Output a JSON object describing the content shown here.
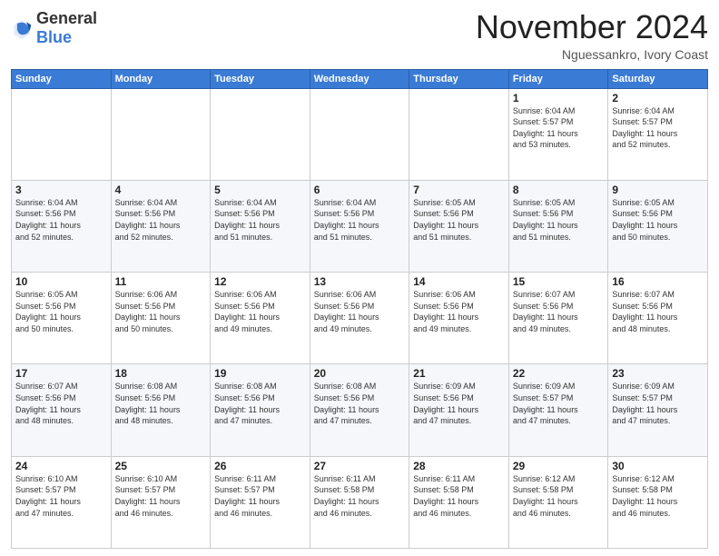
{
  "logo": {
    "general": "General",
    "blue": "Blue"
  },
  "header": {
    "month": "November 2024",
    "location": "Nguessankro, Ivory Coast"
  },
  "weekdays": [
    "Sunday",
    "Monday",
    "Tuesday",
    "Wednesday",
    "Thursday",
    "Friday",
    "Saturday"
  ],
  "weeks": [
    [
      {
        "day": "",
        "info": ""
      },
      {
        "day": "",
        "info": ""
      },
      {
        "day": "",
        "info": ""
      },
      {
        "day": "",
        "info": ""
      },
      {
        "day": "",
        "info": ""
      },
      {
        "day": "1",
        "info": "Sunrise: 6:04 AM\nSunset: 5:57 PM\nDaylight: 11 hours\nand 53 minutes."
      },
      {
        "day": "2",
        "info": "Sunrise: 6:04 AM\nSunset: 5:57 PM\nDaylight: 11 hours\nand 52 minutes."
      }
    ],
    [
      {
        "day": "3",
        "info": "Sunrise: 6:04 AM\nSunset: 5:56 PM\nDaylight: 11 hours\nand 52 minutes."
      },
      {
        "day": "4",
        "info": "Sunrise: 6:04 AM\nSunset: 5:56 PM\nDaylight: 11 hours\nand 52 minutes."
      },
      {
        "day": "5",
        "info": "Sunrise: 6:04 AM\nSunset: 5:56 PM\nDaylight: 11 hours\nand 51 minutes."
      },
      {
        "day": "6",
        "info": "Sunrise: 6:04 AM\nSunset: 5:56 PM\nDaylight: 11 hours\nand 51 minutes."
      },
      {
        "day": "7",
        "info": "Sunrise: 6:05 AM\nSunset: 5:56 PM\nDaylight: 11 hours\nand 51 minutes."
      },
      {
        "day": "8",
        "info": "Sunrise: 6:05 AM\nSunset: 5:56 PM\nDaylight: 11 hours\nand 51 minutes."
      },
      {
        "day": "9",
        "info": "Sunrise: 6:05 AM\nSunset: 5:56 PM\nDaylight: 11 hours\nand 50 minutes."
      }
    ],
    [
      {
        "day": "10",
        "info": "Sunrise: 6:05 AM\nSunset: 5:56 PM\nDaylight: 11 hours\nand 50 minutes."
      },
      {
        "day": "11",
        "info": "Sunrise: 6:06 AM\nSunset: 5:56 PM\nDaylight: 11 hours\nand 50 minutes."
      },
      {
        "day": "12",
        "info": "Sunrise: 6:06 AM\nSunset: 5:56 PM\nDaylight: 11 hours\nand 49 minutes."
      },
      {
        "day": "13",
        "info": "Sunrise: 6:06 AM\nSunset: 5:56 PM\nDaylight: 11 hours\nand 49 minutes."
      },
      {
        "day": "14",
        "info": "Sunrise: 6:06 AM\nSunset: 5:56 PM\nDaylight: 11 hours\nand 49 minutes."
      },
      {
        "day": "15",
        "info": "Sunrise: 6:07 AM\nSunset: 5:56 PM\nDaylight: 11 hours\nand 49 minutes."
      },
      {
        "day": "16",
        "info": "Sunrise: 6:07 AM\nSunset: 5:56 PM\nDaylight: 11 hours\nand 48 minutes."
      }
    ],
    [
      {
        "day": "17",
        "info": "Sunrise: 6:07 AM\nSunset: 5:56 PM\nDaylight: 11 hours\nand 48 minutes."
      },
      {
        "day": "18",
        "info": "Sunrise: 6:08 AM\nSunset: 5:56 PM\nDaylight: 11 hours\nand 48 minutes."
      },
      {
        "day": "19",
        "info": "Sunrise: 6:08 AM\nSunset: 5:56 PM\nDaylight: 11 hours\nand 47 minutes."
      },
      {
        "day": "20",
        "info": "Sunrise: 6:08 AM\nSunset: 5:56 PM\nDaylight: 11 hours\nand 47 minutes."
      },
      {
        "day": "21",
        "info": "Sunrise: 6:09 AM\nSunset: 5:56 PM\nDaylight: 11 hours\nand 47 minutes."
      },
      {
        "day": "22",
        "info": "Sunrise: 6:09 AM\nSunset: 5:57 PM\nDaylight: 11 hours\nand 47 minutes."
      },
      {
        "day": "23",
        "info": "Sunrise: 6:09 AM\nSunset: 5:57 PM\nDaylight: 11 hours\nand 47 minutes."
      }
    ],
    [
      {
        "day": "24",
        "info": "Sunrise: 6:10 AM\nSunset: 5:57 PM\nDaylight: 11 hours\nand 47 minutes."
      },
      {
        "day": "25",
        "info": "Sunrise: 6:10 AM\nSunset: 5:57 PM\nDaylight: 11 hours\nand 46 minutes."
      },
      {
        "day": "26",
        "info": "Sunrise: 6:11 AM\nSunset: 5:57 PM\nDaylight: 11 hours\nand 46 minutes."
      },
      {
        "day": "27",
        "info": "Sunrise: 6:11 AM\nSunset: 5:58 PM\nDaylight: 11 hours\nand 46 minutes."
      },
      {
        "day": "28",
        "info": "Sunrise: 6:11 AM\nSunset: 5:58 PM\nDaylight: 11 hours\nand 46 minutes."
      },
      {
        "day": "29",
        "info": "Sunrise: 6:12 AM\nSunset: 5:58 PM\nDaylight: 11 hours\nand 46 minutes."
      },
      {
        "day": "30",
        "info": "Sunrise: 6:12 AM\nSunset: 5:58 PM\nDaylight: 11 hours\nand 46 minutes."
      }
    ]
  ]
}
